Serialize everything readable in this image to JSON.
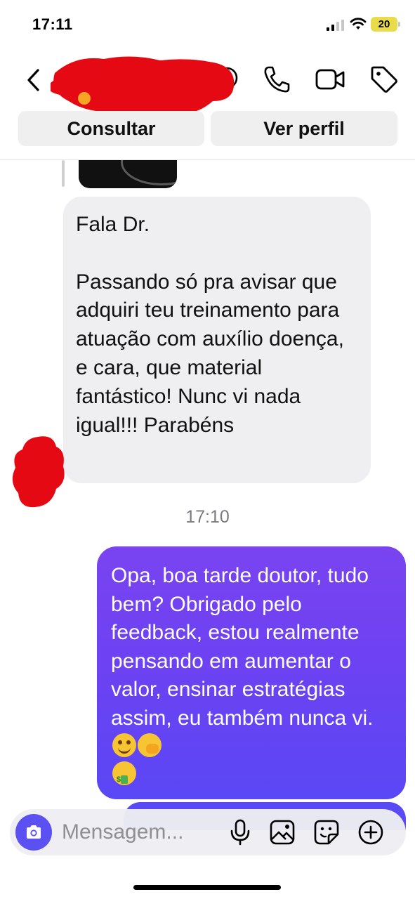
{
  "status_bar": {
    "time": "17:11",
    "battery": "20"
  },
  "header": {
    "contact_name_redacted": true
  },
  "actions": {
    "consultar_label": "Consultar",
    "ver_perfil_label": "Ver perfil"
  },
  "messages": {
    "incoming": {
      "text": "Fala Dr.\n\nPassando só pra avisar que adquiri teu treinamento para atuação com auxílio doença, e cara, que material fantástico! Nunc vi nada igual!!! Parabéns"
    },
    "timestamp": "17:10",
    "outgoing": {
      "text": "Opa, boa tarde doutor, tudo bem? Obrigado pelo feedback, estou realmente pensando em aumentar o valor, ensinar estratégias assim, eu também nunca vi.",
      "emojis": [
        "smiling-face",
        "face-with-hand-over-mouth",
        "money-mouth-face"
      ]
    }
  },
  "composer": {
    "placeholder": "Mensagem..."
  },
  "colors": {
    "outgoing_bubble_top": "#7a43f0",
    "outgoing_bubble_bottom": "#5a47f5",
    "incoming_bubble": "#efeff1",
    "camera_button": "#5b51f3",
    "redaction": "#e50914"
  }
}
